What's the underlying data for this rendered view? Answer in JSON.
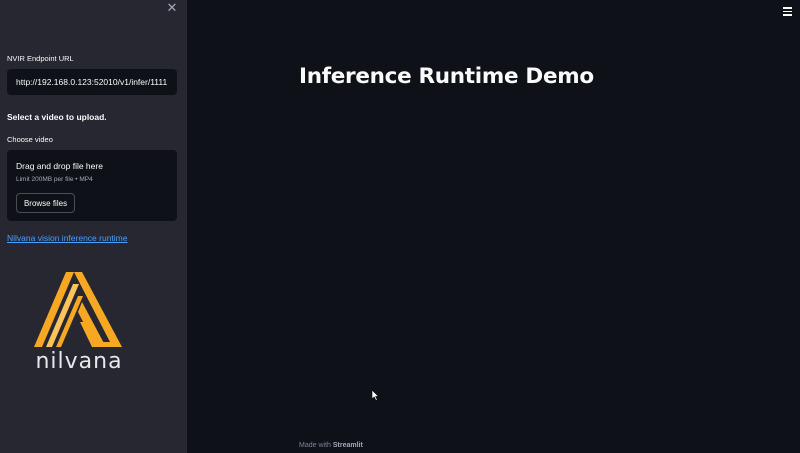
{
  "sidebar": {
    "close_icon": "close-icon",
    "endpoint_label": "NVIR Endpoint URL",
    "endpoint_value": "http://192.168.0.123:52010/v1/infer/1111",
    "upload_title": "Select a video to upload.",
    "choose_label": "Choose video",
    "dropzone": {
      "title": "Drag and drop file here",
      "hint": "Limit 200MB per file • MP4",
      "button_label": "Browse files"
    },
    "link_text": "Nilvana vision inference runtime",
    "logo": {
      "wordmark": "nilvana",
      "colors": {
        "primary": "#f6a823",
        "light": "#fbc35c"
      }
    }
  },
  "main": {
    "title": "Inference Runtime Demo",
    "menu_icon": "hamburger-menu-icon",
    "footer_prefix": "Made with",
    "footer_brand": "Streamlit"
  },
  "colors": {
    "app_bg": "#0e1117",
    "sidebar_bg": "#262730",
    "link": "#4b9fff"
  }
}
